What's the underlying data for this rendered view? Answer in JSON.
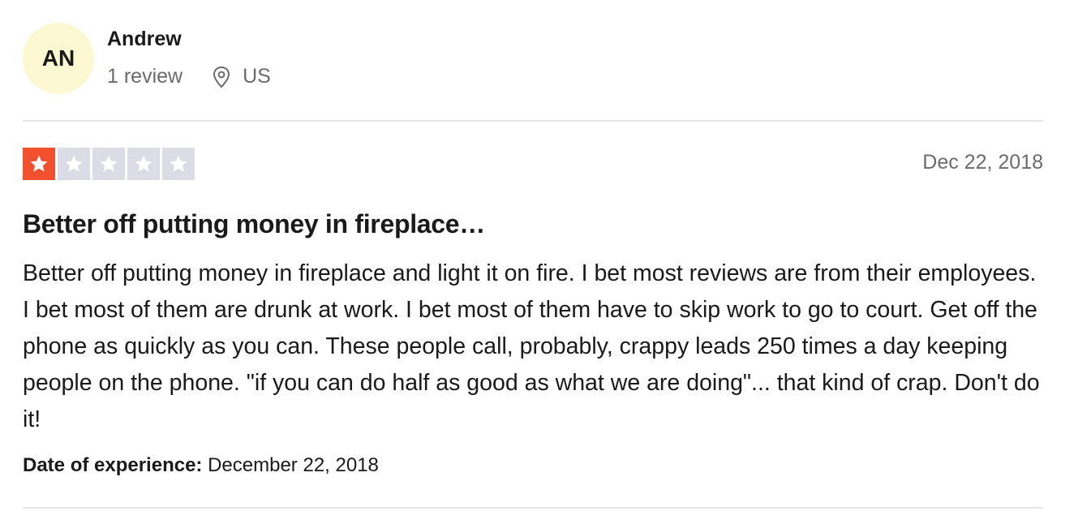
{
  "reviewer": {
    "initials": "AN",
    "avatar_color": "#fcf8d2",
    "name": "Andrew",
    "review_count": "1 review",
    "location_icon": "location-pin-icon",
    "country": "US"
  },
  "review": {
    "rating": 1,
    "max_rating": 5,
    "star_colors": {
      "filled": "#f2502e",
      "empty": "#dcdce6"
    },
    "date": "Dec 22, 2018",
    "title": "Better off putting money in fireplace…",
    "body": "Better off putting money in fireplace and light it on fire. I bet most reviews are from their employees. I bet most of them are drunk at work. I bet most of them have to skip work to go to court. Get off the phone as quickly as you can. These people call, probably, crappy leads 250 times a day keeping people on the phone. \"if you can do half as good as what we are doing\"... that kind of crap. Don't do it!",
    "experience_label": "Date of experience:",
    "experience_date": "December 22, 2018"
  }
}
